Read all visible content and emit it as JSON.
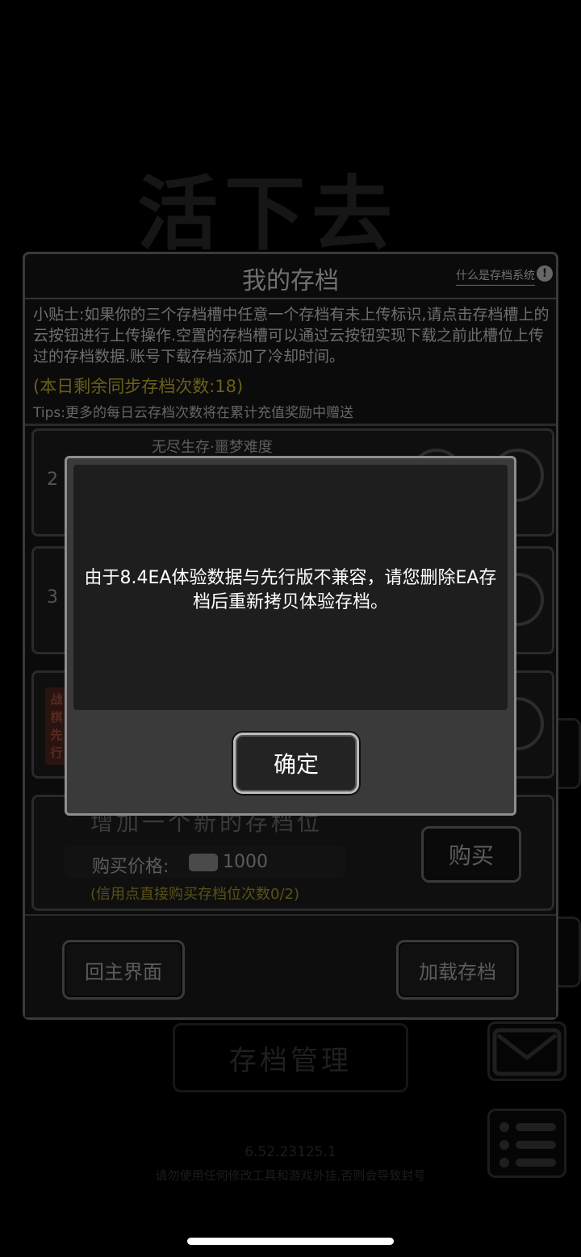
{
  "background": {
    "game_title": "活下去",
    "manage_button": "存档管理",
    "version": "6.52.23125.1",
    "warning": "请勿使用任何修改工具和游戏外挂,否则会导致封号"
  },
  "panel": {
    "title": "我的存档",
    "help_link": "什么是存档系统",
    "help_icon": "!",
    "tip_main": "小贴士:如果你的三个存档槽中任意一个存档有未上传标识,请点击存档槽上的云按钮进行上传操作.空置的存档槽可以通过云按钮实现下载之前此槽位上传过的存档数据.账号下载存档添加了冷却时间。",
    "tip_count": "(本日剩余同步存档次数:18)",
    "tip_more": "Tips:更多的每日云存档次数将在累计充值奖励中赠送",
    "slots": [
      {
        "number": "2",
        "name": "无尽生存·噩梦难度"
      },
      {
        "number": "3",
        "name": ""
      },
      {
        "badge": "战棋先行"
      }
    ],
    "buy": {
      "title": "增加一个新的存档位",
      "price_label": "购买价格:",
      "price_value": "1000",
      "note": "(信用点直接购买存档位次数0/2)",
      "button": "购买"
    },
    "footer": {
      "home_button": "回主界面",
      "load_button": "加载存档"
    }
  },
  "modal": {
    "message": "由于8.4EA体验数据与先行版不兼容，请您删除EA存档后重新拷贝体验存档。",
    "confirm_button": "确定"
  },
  "colors": {
    "modal_border": "#8e8e8e",
    "modal_body": "#1e1e1e",
    "tip_highlight": "#6a6018"
  }
}
